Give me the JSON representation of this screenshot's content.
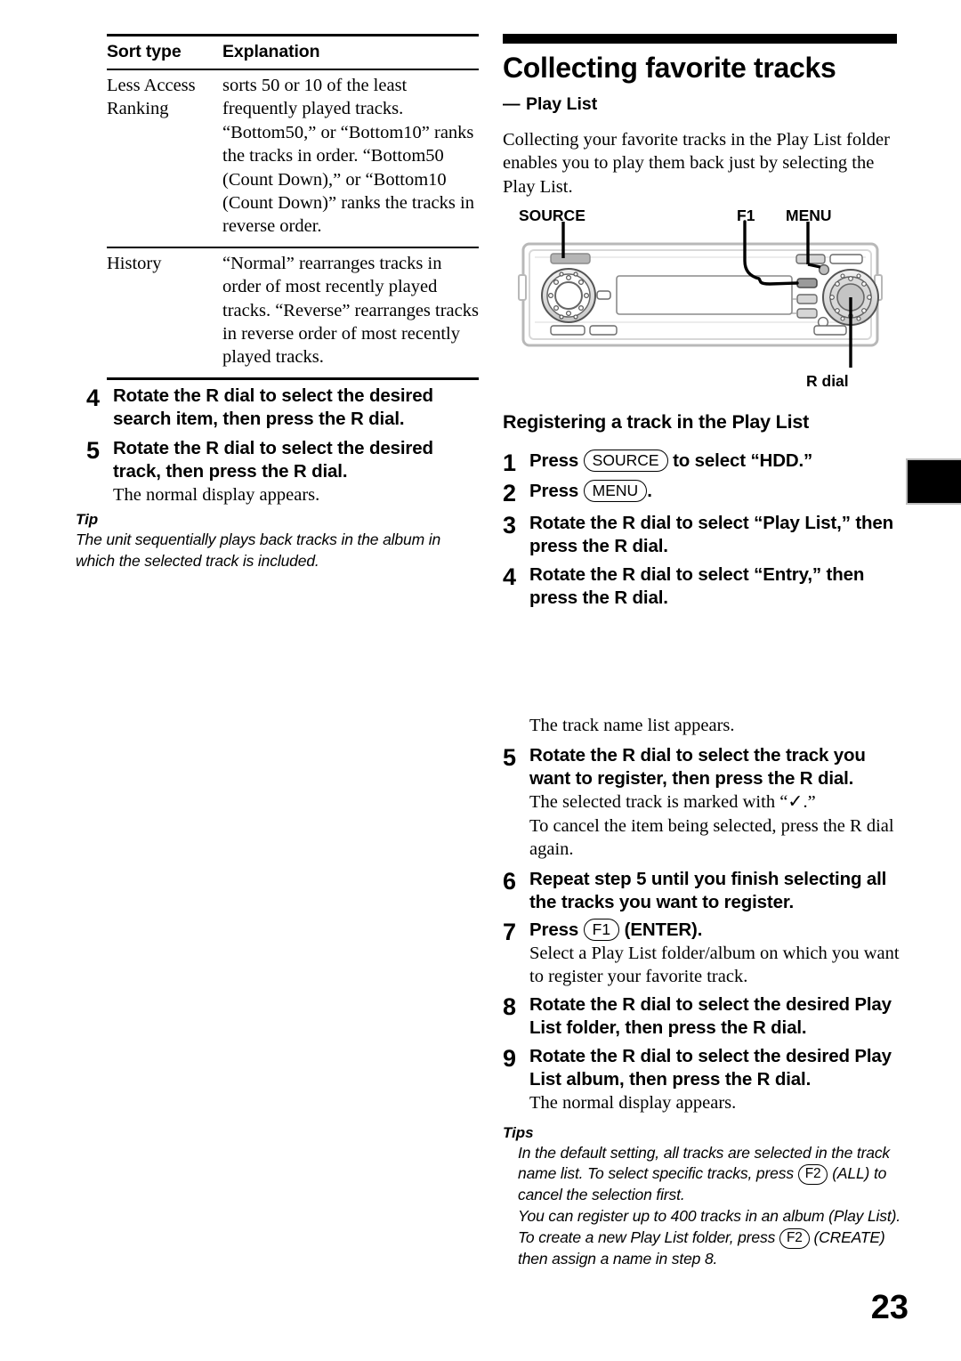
{
  "page_number": "23",
  "table": {
    "headers": [
      "Sort type",
      "Explanation"
    ],
    "rows": [
      {
        "type": "Less Access Ranking",
        "explanation": "sorts 50 or 10 of the least frequently played tracks. “Bottom50,” or “Bottom10” ranks the tracks in order. “Bottom50 (Count Down),” or “Bottom10 (Count Down)” ranks the tracks in reverse order."
      },
      {
        "type": "History",
        "explanation": "“Normal” rearranges tracks in order of most recently played tracks. “Reverse” rearranges tracks in reverse order of most recently played tracks."
      }
    ]
  },
  "left_steps": [
    {
      "num": "4",
      "title": "Rotate the R dial to select the desired search item, then press the R dial.",
      "desc": ""
    },
    {
      "num": "5",
      "title": "Rotate the R dial to select the desired track, then press the R dial.",
      "desc": "The normal display appears."
    }
  ],
  "left_tip": {
    "heading": "Tip",
    "text": "The unit sequentially plays back tracks in the album in which the selected track is included."
  },
  "right": {
    "title": "Collecting favorite tracks",
    "subtitle_dash": "—",
    "subtitle": "Play List",
    "intro": "Collecting your favorite tracks in the Play List folder enables you to play them back just by selecting the Play List.",
    "section_title": "Registering a track in the Play List",
    "after_step4_note": "The track name list appears."
  },
  "diagram": {
    "labels": {
      "source": "SOURCE",
      "f1": "F1",
      "menu": "MENU",
      "rdial": "R dial"
    }
  },
  "right_steps": [
    {
      "num": "1",
      "pre": "Press ",
      "button": "SOURCE",
      "post": " to select “HDD.”",
      "desc": ""
    },
    {
      "num": "2",
      "pre": "Press ",
      "button": "MENU",
      "post": ".",
      "desc": ""
    },
    {
      "num": "3",
      "title": "Rotate the R dial to select “Play List,” then press the R dial.",
      "desc": ""
    },
    {
      "num": "4",
      "title": "Rotate the R dial to select “Entry,” then press the R dial.",
      "desc": ""
    },
    {
      "num": "5",
      "title": "Rotate the R dial to select the track you want to register, then press the R dial.",
      "desc_line1": "The selected track is marked with “✓.”",
      "desc_line2": "To cancel the item being selected, press the R dial again."
    },
    {
      "num": "6",
      "title": "Repeat step 5 until you finish selecting all the tracks you want to register.",
      "desc": ""
    },
    {
      "num": "7",
      "pre": "Press ",
      "button": "F1",
      "post": " (ENTER).",
      "desc": "Select a Play List folder/album on which you want to register your favorite track."
    },
    {
      "num": "8",
      "title": "Rotate the R dial to select the desired Play List folder, then press the R dial.",
      "desc": ""
    },
    {
      "num": "9",
      "title": "Rotate the R dial to select the desired Play List album, then press the R dial.",
      "desc": "The normal display appears."
    }
  ],
  "right_tips": {
    "heading": "Tips",
    "item1_a": "In the default setting, all tracks are selected in the track name list. To select specific tracks, press ",
    "item1_btn": "F2",
    "item1_b": " (ALL) to cancel the selection first.",
    "item2_a": "You can register up to 400 tracks in an album (Play List). To create a new Play List folder, press ",
    "item2_btn": "F2",
    "item2_b": " (CREATE) then assign a name in step 8."
  }
}
